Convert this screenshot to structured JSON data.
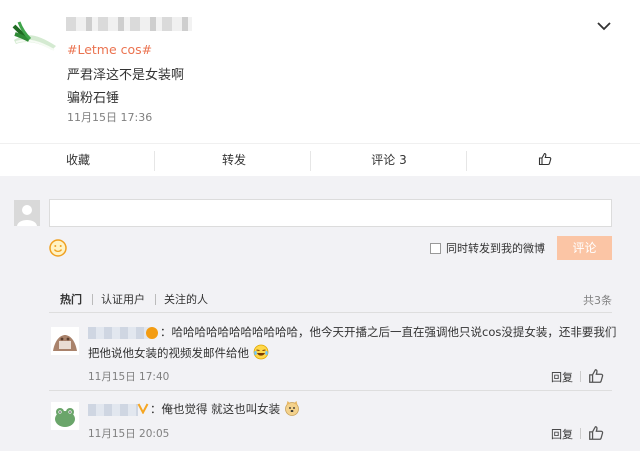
{
  "post": {
    "hashtag": "#Letme cos#",
    "line1": "严君泽这不是女装啊",
    "line2": "骗粉石锤",
    "time": "11月15日 17:36",
    "actions": {
      "favorite": "收藏",
      "forward": "转发",
      "comment": "评论 3"
    }
  },
  "comment_box": {
    "forward_label": "同时转发到我的微博",
    "submit": "评论"
  },
  "tabs": {
    "hot": "热门",
    "verified": "认证用户",
    "following": "关注的人",
    "count": "共3条"
  },
  "comments": [
    {
      "text_line1": "：哈哈哈哈哈哈哈哈哈哈哈，他今天开播之后一直在强调他只说cos没提女装，还非要我们",
      "text_line2": "把他说他女装的视频发邮件给他",
      "time": "11月15日 17:40",
      "reply": "回复"
    },
    {
      "text_line1": "：俺也觉得 就这也叫女装",
      "time": "11月15日 20:05",
      "reply": "回复"
    }
  ],
  "colors": {
    "accent": "#eb7350",
    "submit_disabled": "#fbc5a5",
    "background": "#f2f2f5"
  }
}
